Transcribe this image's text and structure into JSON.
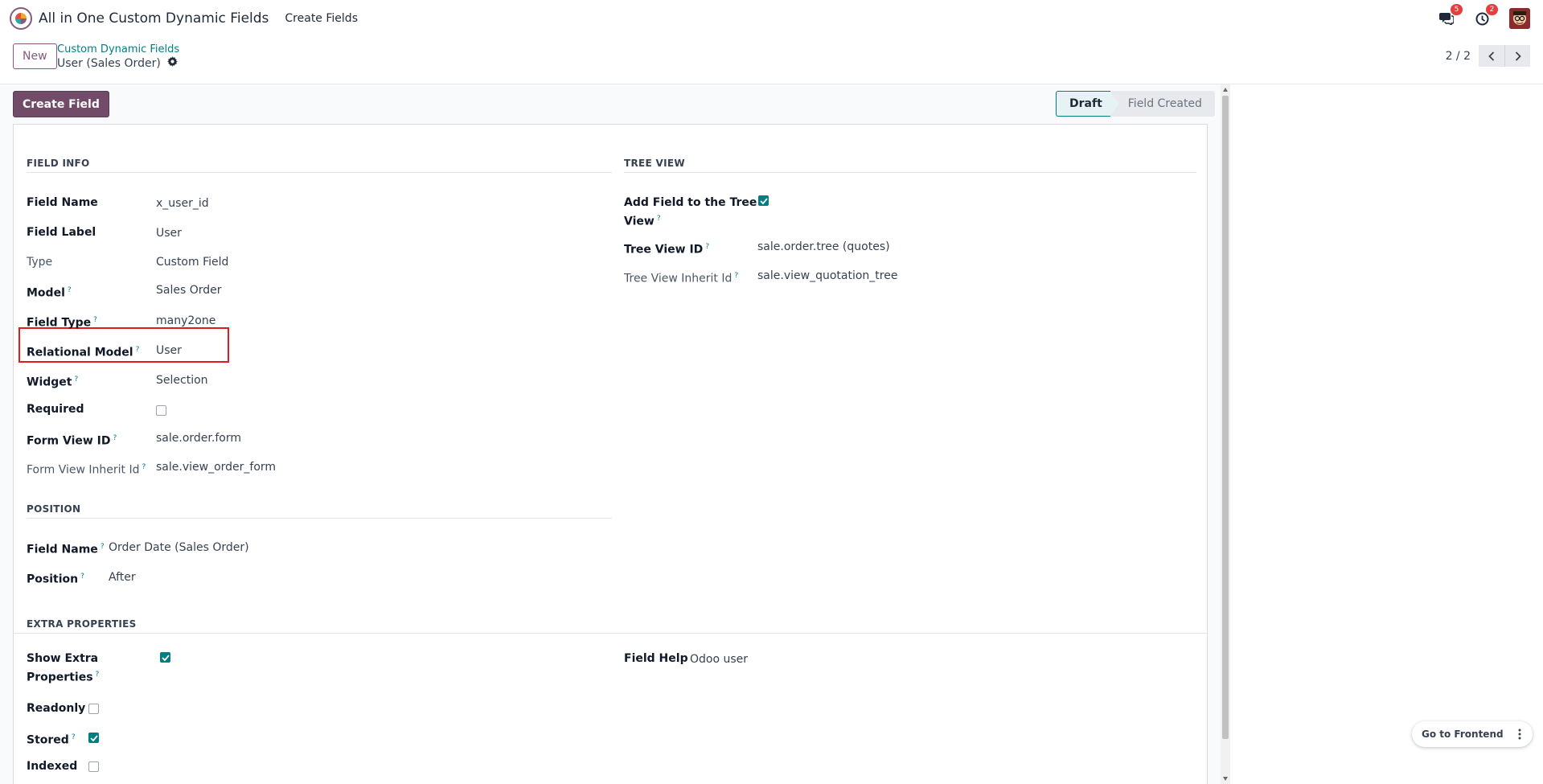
{
  "navbar": {
    "app_name": "All in One Custom Dynamic Fields",
    "menu_create_fields": "Create Fields",
    "messages_count": "5",
    "activities_count": "2"
  },
  "control": {
    "new_label": "New",
    "breadcrumb_parent": "Custom Dynamic Fields",
    "breadcrumb_current": "User (Sales Order)",
    "pager": "2 / 2"
  },
  "actions": {
    "create_field": "Create Field"
  },
  "statusbar": {
    "draft": "Draft",
    "field_created": "Field Created"
  },
  "field_info": {
    "title": "FIELD INFO",
    "field_name_label": "Field Name",
    "field_name": "x_user_id",
    "field_label_label": "Field Label",
    "field_label": "User",
    "type_label": "Type",
    "type": "Custom Field",
    "model_label": "Model",
    "model": "Sales Order",
    "field_type_label": "Field Type",
    "field_type": "many2one",
    "relational_model_label": "Relational Model",
    "relational_model": "User",
    "widget_label": "Widget",
    "widget": "Selection",
    "required_label": "Required",
    "required": false,
    "form_view_id_label": "Form View ID",
    "form_view_id": "sale.order.form",
    "form_view_inherit_label": "Form View Inherit Id",
    "form_view_inherit": "sale.view_order_form"
  },
  "tree_view": {
    "title": "TREE VIEW",
    "add_field_label_1": "Add Field to the Tree",
    "add_field_label_2": "View",
    "add_field": true,
    "tree_view_id_label": "Tree View ID",
    "tree_view_id": "sale.order.tree (quotes)",
    "tree_view_inherit_label": "Tree View Inherit Id",
    "tree_view_inherit": "sale.view_quotation_tree"
  },
  "position": {
    "title": "POSITION",
    "field_name_label": "Field Name",
    "field_name": "Order Date (Sales Order)",
    "position_label": "Position",
    "position": "After"
  },
  "extra": {
    "title": "EXTRA PROPERTIES",
    "show_extra_label_1": "Show Extra",
    "show_extra_label_2": "Properties",
    "show_extra": true,
    "field_help_label": "Field Help",
    "field_help": "Odoo user",
    "readonly_label": "Readonly",
    "readonly": false,
    "stored_label": "Stored",
    "stored": true,
    "indexed_label": "Indexed",
    "indexed": false
  },
  "help_marker": "?",
  "frontend": {
    "label": "Go to Frontend"
  },
  "colors": {
    "brand": "#714b67",
    "teal": "#017e84",
    "highlight": "#e31a1c"
  }
}
